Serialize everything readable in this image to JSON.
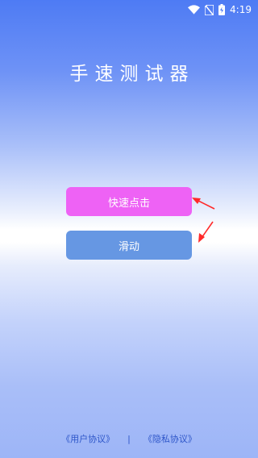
{
  "status_bar": {
    "time": "4:19",
    "icons": [
      "wifi-icon",
      "no-sim-icon",
      "battery-icon"
    ]
  },
  "app": {
    "title": "手速测试器"
  },
  "buttons": {
    "fast_click": "快速点击",
    "slide": "滑动"
  },
  "footer": {
    "user_agreement": "《用户协议》",
    "separator": "|",
    "privacy_agreement": "《隐私协议》"
  },
  "colors": {
    "fast_click_button": "#ee62f5",
    "slide_button": "#6697e3",
    "arrow": "#ff2a2a",
    "link": "#2e56c9"
  }
}
